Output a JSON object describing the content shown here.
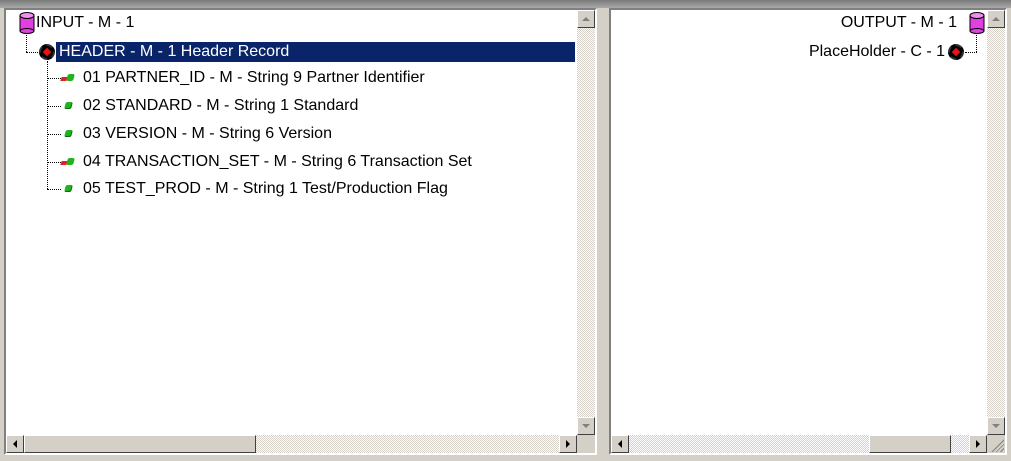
{
  "input": {
    "root_label": "INPUT - M - 1",
    "header_label": "HEADER - M -  1 Header Record",
    "children": [
      {
        "label": "01 PARTNER_ID - M - String 9 Partner Identifier",
        "icon": "mapped-leaf-icon"
      },
      {
        "label": "02 STANDARD - M - String 1 Standard",
        "icon": "leaf-icon"
      },
      {
        "label": "03 VERSION - M - String 6 Version",
        "icon": "leaf-icon"
      },
      {
        "label": "04 TRANSACTION_SET - M - String 6 Transaction Set",
        "icon": "mapped-leaf-icon"
      },
      {
        "label": "05 TEST_PROD - M - String 1 Test/Production Flag",
        "icon": "leaf-icon"
      }
    ]
  },
  "output": {
    "root_label": "OUTPUT - M - 1",
    "child_label": "PlaceHolder - C - 1"
  },
  "colors": {
    "selection": "#0a246a",
    "database_icon": "#e040e0",
    "leaf_green": "#1fb41f",
    "leaf_red": "#e02222"
  }
}
